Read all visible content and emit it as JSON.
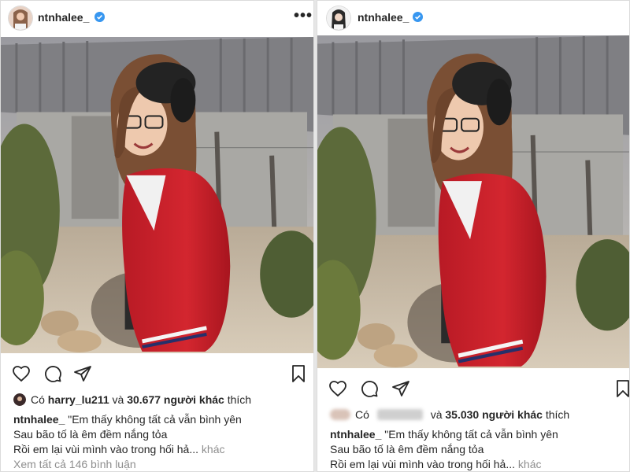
{
  "posts": [
    {
      "username": "ntnhalee_",
      "more_label": "•••",
      "likes": {
        "prefix": "Có",
        "liker": "harry_lu211",
        "conjunction": "và",
        "count": "30.677 người khác",
        "suffix": "thích"
      },
      "caption": {
        "user": "ntnhalee_",
        "line1": "\"Em thấy không tất cả vẫn bình yên",
        "line2": "Sau bão tố là êm đềm nắng tỏa",
        "line3": "Rồi em lại vùi mình vào trong hối hả...",
        "more": "khác"
      },
      "view_comments": "Xem tất cả 146 bình luận"
    },
    {
      "username": "ntnhalee_",
      "more_label": "•••",
      "likes": {
        "prefix": "Có",
        "conjunction": "và",
        "count": "35.030 người khác",
        "suffix": "thích"
      },
      "caption": {
        "user": "ntnhalee_",
        "line1": "\"Em thấy không tất cả vẫn bình yên",
        "line2": "Sau bão tố là êm đềm nắng tỏa",
        "line3": "Rồi em lại vùi mình vào trong hối hả...",
        "more": "khác"
      }
    }
  ],
  "icons": [
    "heart-icon",
    "comment-icon",
    "share-icon",
    "bookmark-icon",
    "verified-badge-icon",
    "more-options-icon"
  ],
  "colors": {
    "text": "#262626",
    "muted": "#8e8e8e",
    "verified": "#3897f0",
    "border": "#dbdbdb",
    "cardigan_red": "#c8202a"
  }
}
